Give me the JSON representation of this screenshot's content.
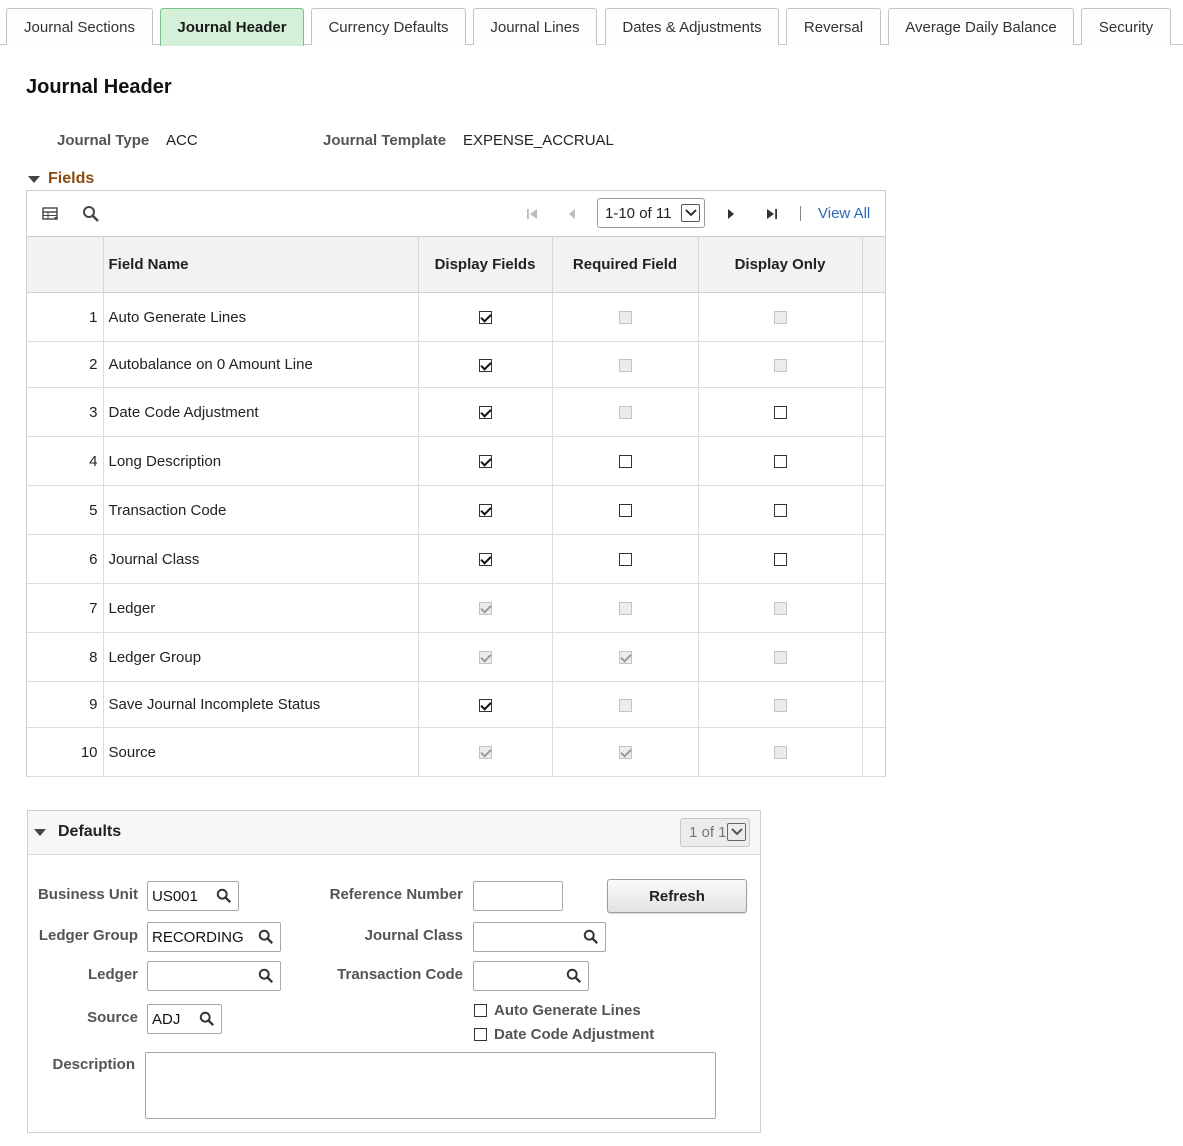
{
  "tabs": [
    {
      "label": "Journal Sections",
      "active": false
    },
    {
      "label": "Journal Header",
      "active": true
    },
    {
      "label": "Currency Defaults",
      "active": false
    },
    {
      "label": "Journal Lines",
      "active": false
    },
    {
      "label": "Dates & Adjustments",
      "active": false
    },
    {
      "label": "Reversal",
      "active": false
    },
    {
      "label": "Average Daily Balance",
      "active": false
    },
    {
      "label": "Security",
      "active": false
    }
  ],
  "page_title": "Journal Header",
  "info": {
    "journal_type_label": "Journal Type",
    "journal_type_value": "ACC",
    "journal_template_label": "Journal Template",
    "journal_template_value": "EXPENSE_ACCRUAL"
  },
  "fields_section": {
    "title": "Fields",
    "pager_text": "1-10 of 11",
    "view_all": "View All",
    "columns": [
      "Field Name",
      "Display Fields",
      "Required Field",
      "Display Only"
    ],
    "rows": [
      {
        "num": "1",
        "name": "Auto Generate Lines",
        "display": [
          true,
          true
        ],
        "required": [
          false,
          false
        ],
        "display_only": [
          false,
          false
        ]
      },
      {
        "num": "2",
        "name": "Autobalance on 0 Amount Line",
        "display": [
          true,
          true
        ],
        "required": [
          false,
          false
        ],
        "display_only": [
          false,
          false
        ]
      },
      {
        "num": "3",
        "name": "Date Code  Adjustment",
        "display": [
          true,
          true
        ],
        "required": [
          false,
          false
        ],
        "display_only": [
          false,
          true
        ]
      },
      {
        "num": "4",
        "name": "Long Description",
        "display": [
          true,
          true
        ],
        "required": [
          false,
          true
        ],
        "display_only": [
          false,
          true
        ]
      },
      {
        "num": "5",
        "name": "Transaction Code",
        "display": [
          true,
          true
        ],
        "required": [
          false,
          true
        ],
        "display_only": [
          false,
          true
        ]
      },
      {
        "num": "6",
        "name": "Journal Class",
        "display": [
          true,
          true
        ],
        "required": [
          false,
          true
        ],
        "display_only": [
          false,
          true
        ]
      },
      {
        "num": "7",
        "name": "Ledger",
        "display": [
          true,
          false
        ],
        "required": [
          false,
          false
        ],
        "display_only": [
          false,
          false
        ]
      },
      {
        "num": "8",
        "name": "Ledger Group",
        "display": [
          true,
          false
        ],
        "required": [
          true,
          false
        ],
        "display_only": [
          false,
          false
        ]
      },
      {
        "num": "9",
        "name": "Save Journal Incomplete Status",
        "display": [
          true,
          true
        ],
        "required": [
          false,
          false
        ],
        "display_only": [
          false,
          false
        ]
      },
      {
        "num": "10",
        "name": "Source",
        "display": [
          true,
          false
        ],
        "required": [
          true,
          false
        ],
        "display_only": [
          false,
          false
        ]
      }
    ]
  },
  "defaults": {
    "title": "Defaults",
    "pager_text": "1 of 1",
    "business_unit_label": "Business Unit",
    "business_unit_value": "US001",
    "ledger_group_label": "Ledger Group",
    "ledger_group_value": "RECORDING",
    "ledger_label": "Ledger",
    "ledger_value": "",
    "source_label": "Source",
    "source_value": "ADJ",
    "reference_number_label": "Reference Number",
    "reference_number_value": "",
    "journal_class_label": "Journal Class",
    "journal_class_value": "",
    "transaction_code_label": "Transaction Code",
    "transaction_code_value": "",
    "refresh_label": "Refresh",
    "auto_generate_lines_label": "Auto Generate Lines",
    "date_code_adjustment_label": "Date Code Adjustment",
    "description_label": "Description",
    "description_value": ""
  }
}
